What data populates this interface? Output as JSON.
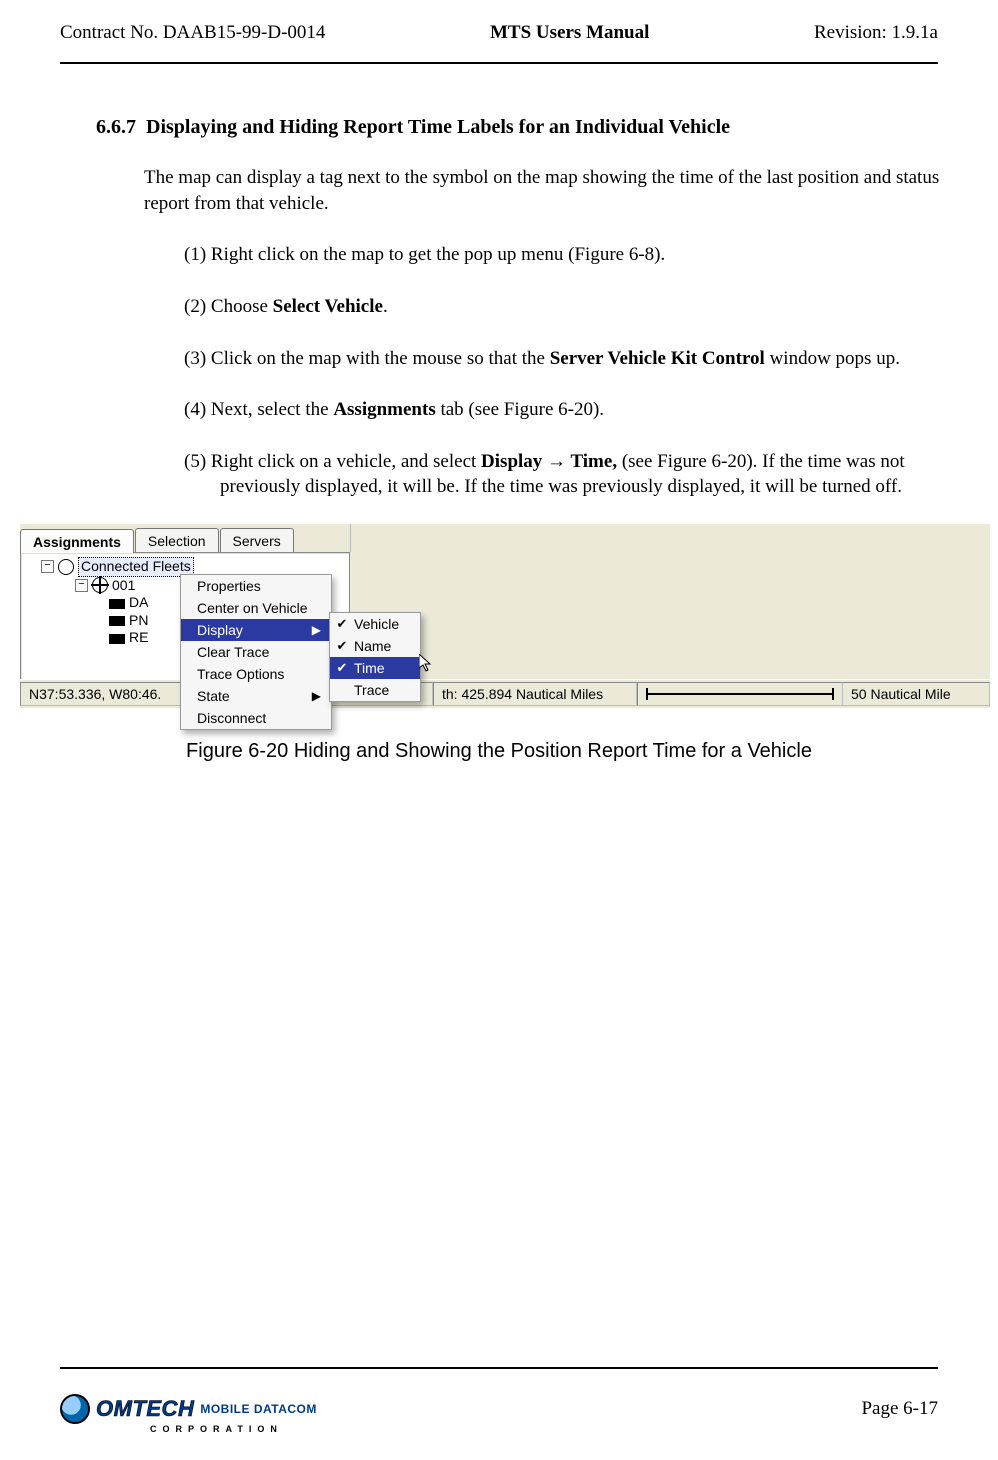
{
  "header": {
    "contract": "Contract No. DAAB15-99-D-0014",
    "title": "MTS Users Manual",
    "revision": "Revision:  1.9.1a"
  },
  "section": {
    "number": "6.6.7",
    "title": "Displaying and Hiding Report Time Labels for an Individual Vehicle"
  },
  "intro": "The map can display a tag next to the symbol on the map showing the time of the last position and status report from that vehicle.",
  "steps": {
    "s1": "(1) Right click on the map to get the pop up menu (Figure 6-8).",
    "s2_pre": "(2) Choose ",
    "s2_bold": "Select Vehicle",
    "s2_post": ".",
    "s3_pre": "(3) Click on the map with the mouse so that the ",
    "s3_bold": "Server Vehicle Kit Control",
    "s3_post": " window pops up.",
    "s4_pre": "(4) Next, select the ",
    "s4_bold": "Assignments",
    "s4_post": " tab (see Figure 6-20).",
    "s5_pre": "(5) Right click on a vehicle, and select ",
    "s5_b1": "Display ",
    "s5_arrow": "→",
    "s5_b2": " Time,",
    "s5_post": " (see Figure 6-20).  If the time was not previously displayed, it will be. If the time was previously displayed, it will be turned off."
  },
  "screenshot": {
    "tabs": {
      "assignments": "Assignments",
      "selection": "Selection",
      "servers": "Servers"
    },
    "tree": {
      "root": "Connected Fleets",
      "fleet": "001",
      "v1": "DA",
      "v2": "PN",
      "v3": "RE"
    },
    "context_menu": {
      "properties": "Properties",
      "center": "Center on Vehicle",
      "display": "Display",
      "clear": "Clear Trace",
      "trace_opts": "Trace Options",
      "state": "State",
      "disconnect": "Disconnect"
    },
    "submenu": {
      "vehicle": "Vehicle",
      "name": "Name",
      "time": "Time",
      "trace": "Trace"
    },
    "status": {
      "coords": "N37:53.336, W80:46.",
      "width_label": "th: 425.894 Nautical Miles",
      "scale_label": "50 Nautical Mile"
    }
  },
  "figure_caption": "Figure 6-20   Hiding and Showing the Position Report Time for a Vehicle",
  "footer": {
    "logo_main": "OMTECH",
    "logo_right": "MOBILE DATACOM",
    "logo_sub": "CORPORATION",
    "page": "Page 6-17"
  }
}
